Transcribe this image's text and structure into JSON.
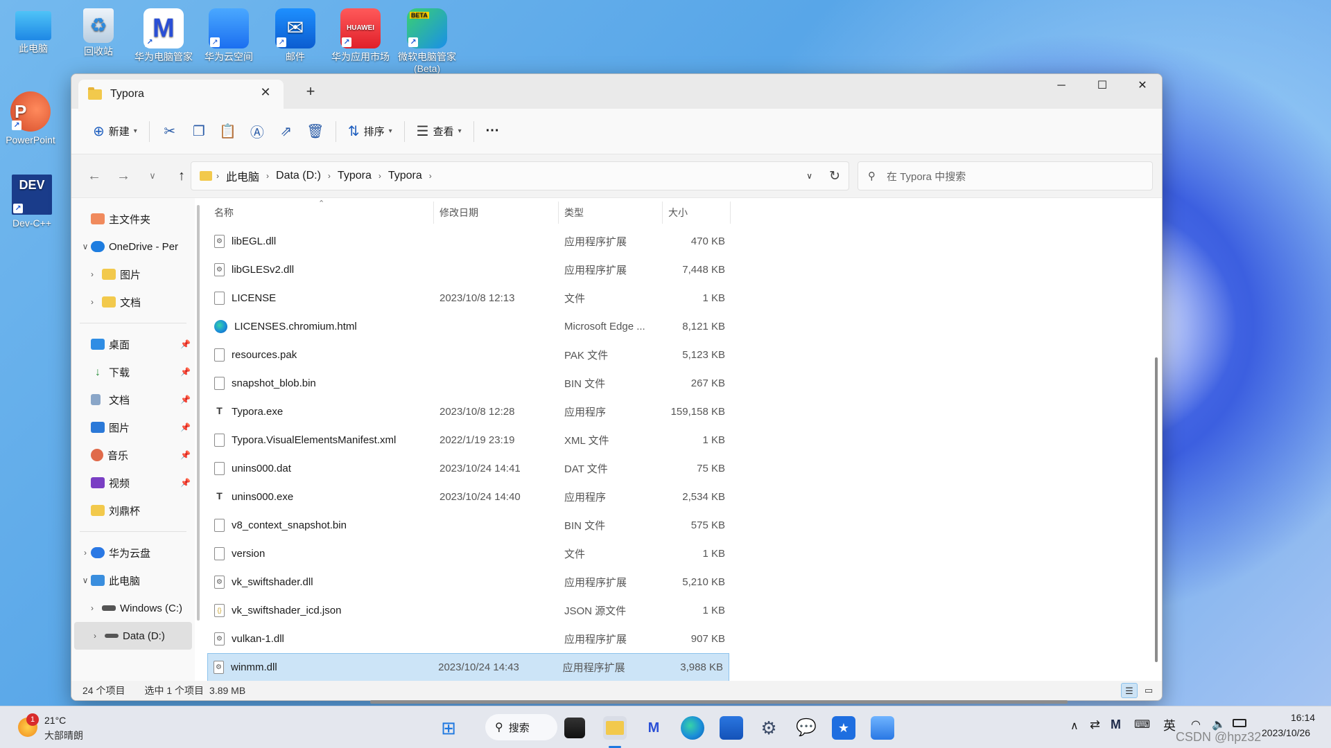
{
  "desktop": {
    "icons": [
      {
        "label": "此电脑"
      },
      {
        "label": "回收站"
      },
      {
        "label": "华为电脑管家"
      },
      {
        "label": "华为云空间"
      },
      {
        "label": "邮件"
      },
      {
        "label": "华为应用市场"
      },
      {
        "label": "微软电脑管家 (Beta)"
      },
      {
        "label": "PowerPoint"
      },
      {
        "label": "Dev-C++"
      }
    ],
    "beta_badge": "BETA",
    "huawei_badge": "HUAWEI"
  },
  "window": {
    "tab_title": "Typora",
    "tab_close": "✕",
    "new_tab": "+",
    "controls": {
      "minimize": "─",
      "maximize": "☐",
      "close": "✕"
    }
  },
  "toolbar": {
    "new_label": "新建",
    "sort_label": "排序",
    "view_label": "查看",
    "more_label": "···"
  },
  "address": {
    "crumbs": [
      "此电脑",
      "Data (D:)",
      "Typora",
      "Typora"
    ],
    "search_placeholder": "在 Typora 中搜索"
  },
  "sidebar": {
    "home": "主文件夹",
    "onedrive": "OneDrive - Per",
    "od_children": [
      "图片",
      "文档"
    ],
    "quick": [
      "桌面",
      "下载",
      "文档",
      "图片",
      "音乐",
      "视频",
      "刘鼎杯"
    ],
    "huawei_cloud": "华为云盘",
    "this_pc": "此电脑",
    "drive_c": "Windows (C:)",
    "drive_d": "Data (D:)"
  },
  "list": {
    "columns": {
      "name": "名称",
      "modified": "修改日期",
      "type": "类型",
      "size": "大小"
    },
    "rows": [
      {
        "name": "libEGL.dll",
        "modified": "",
        "type": "应用程序扩展",
        "size": "470 KB",
        "icon": "dll-icon"
      },
      {
        "name": "libGLESv2.dll",
        "modified": "",
        "type": "应用程序扩展",
        "size": "7,448 KB",
        "icon": "dll-icon"
      },
      {
        "name": "LICENSE",
        "modified": "2023/10/8 12:13",
        "type": "文件",
        "size": "1 KB",
        "icon": "file-icon"
      },
      {
        "name": "LICENSES.chromium.html",
        "modified": "",
        "type": "Microsoft Edge ...",
        "size": "8,121 KB",
        "icon": "edge-icon"
      },
      {
        "name": "resources.pak",
        "modified": "",
        "type": "PAK 文件",
        "size": "5,123 KB",
        "icon": "file-icon"
      },
      {
        "name": "snapshot_blob.bin",
        "modified": "",
        "type": "BIN 文件",
        "size": "267 KB",
        "icon": "file-icon"
      },
      {
        "name": "Typora.exe",
        "modified": "2023/10/8 12:28",
        "type": "应用程序",
        "size": "159,158 KB",
        "icon": "typora-icon"
      },
      {
        "name": "Typora.VisualElementsManifest.xml",
        "modified": "2022/1/19 23:19",
        "type": "XML 文件",
        "size": "1 KB",
        "icon": "file-icon"
      },
      {
        "name": "unins000.dat",
        "modified": "2023/10/24 14:41",
        "type": "DAT 文件",
        "size": "75 KB",
        "icon": "file-icon"
      },
      {
        "name": "unins000.exe",
        "modified": "2023/10/24 14:40",
        "type": "应用程序",
        "size": "2,534 KB",
        "icon": "typora-icon"
      },
      {
        "name": "v8_context_snapshot.bin",
        "modified": "",
        "type": "BIN 文件",
        "size": "575 KB",
        "icon": "file-icon"
      },
      {
        "name": "version",
        "modified": "",
        "type": "文件",
        "size": "1 KB",
        "icon": "file-icon"
      },
      {
        "name": "vk_swiftshader.dll",
        "modified": "",
        "type": "应用程序扩展",
        "size": "5,210 KB",
        "icon": "dll-icon"
      },
      {
        "name": "vk_swiftshader_icd.json",
        "modified": "",
        "type": "JSON 源文件",
        "size": "1 KB",
        "icon": "json-icon"
      },
      {
        "name": "vulkan-1.dll",
        "modified": "",
        "type": "应用程序扩展",
        "size": "907 KB",
        "icon": "dll-icon"
      },
      {
        "name": "winmm.dll",
        "modified": "2023/10/24 14:43",
        "type": "应用程序扩展",
        "size": "3,988 KB",
        "icon": "dll-icon",
        "selected": true
      }
    ]
  },
  "status": {
    "count": "24 个项目",
    "selection": "选中 1 个项目",
    "selection_size": "3.89 MB"
  },
  "taskbar": {
    "weather_temp": "21°C",
    "weather_desc": "大部晴朗",
    "weather_badge": "1",
    "search_label": "搜索",
    "ime": "英",
    "time": "16:14",
    "date": "2023/10/26",
    "watermark": "CSDN @hpz32"
  }
}
